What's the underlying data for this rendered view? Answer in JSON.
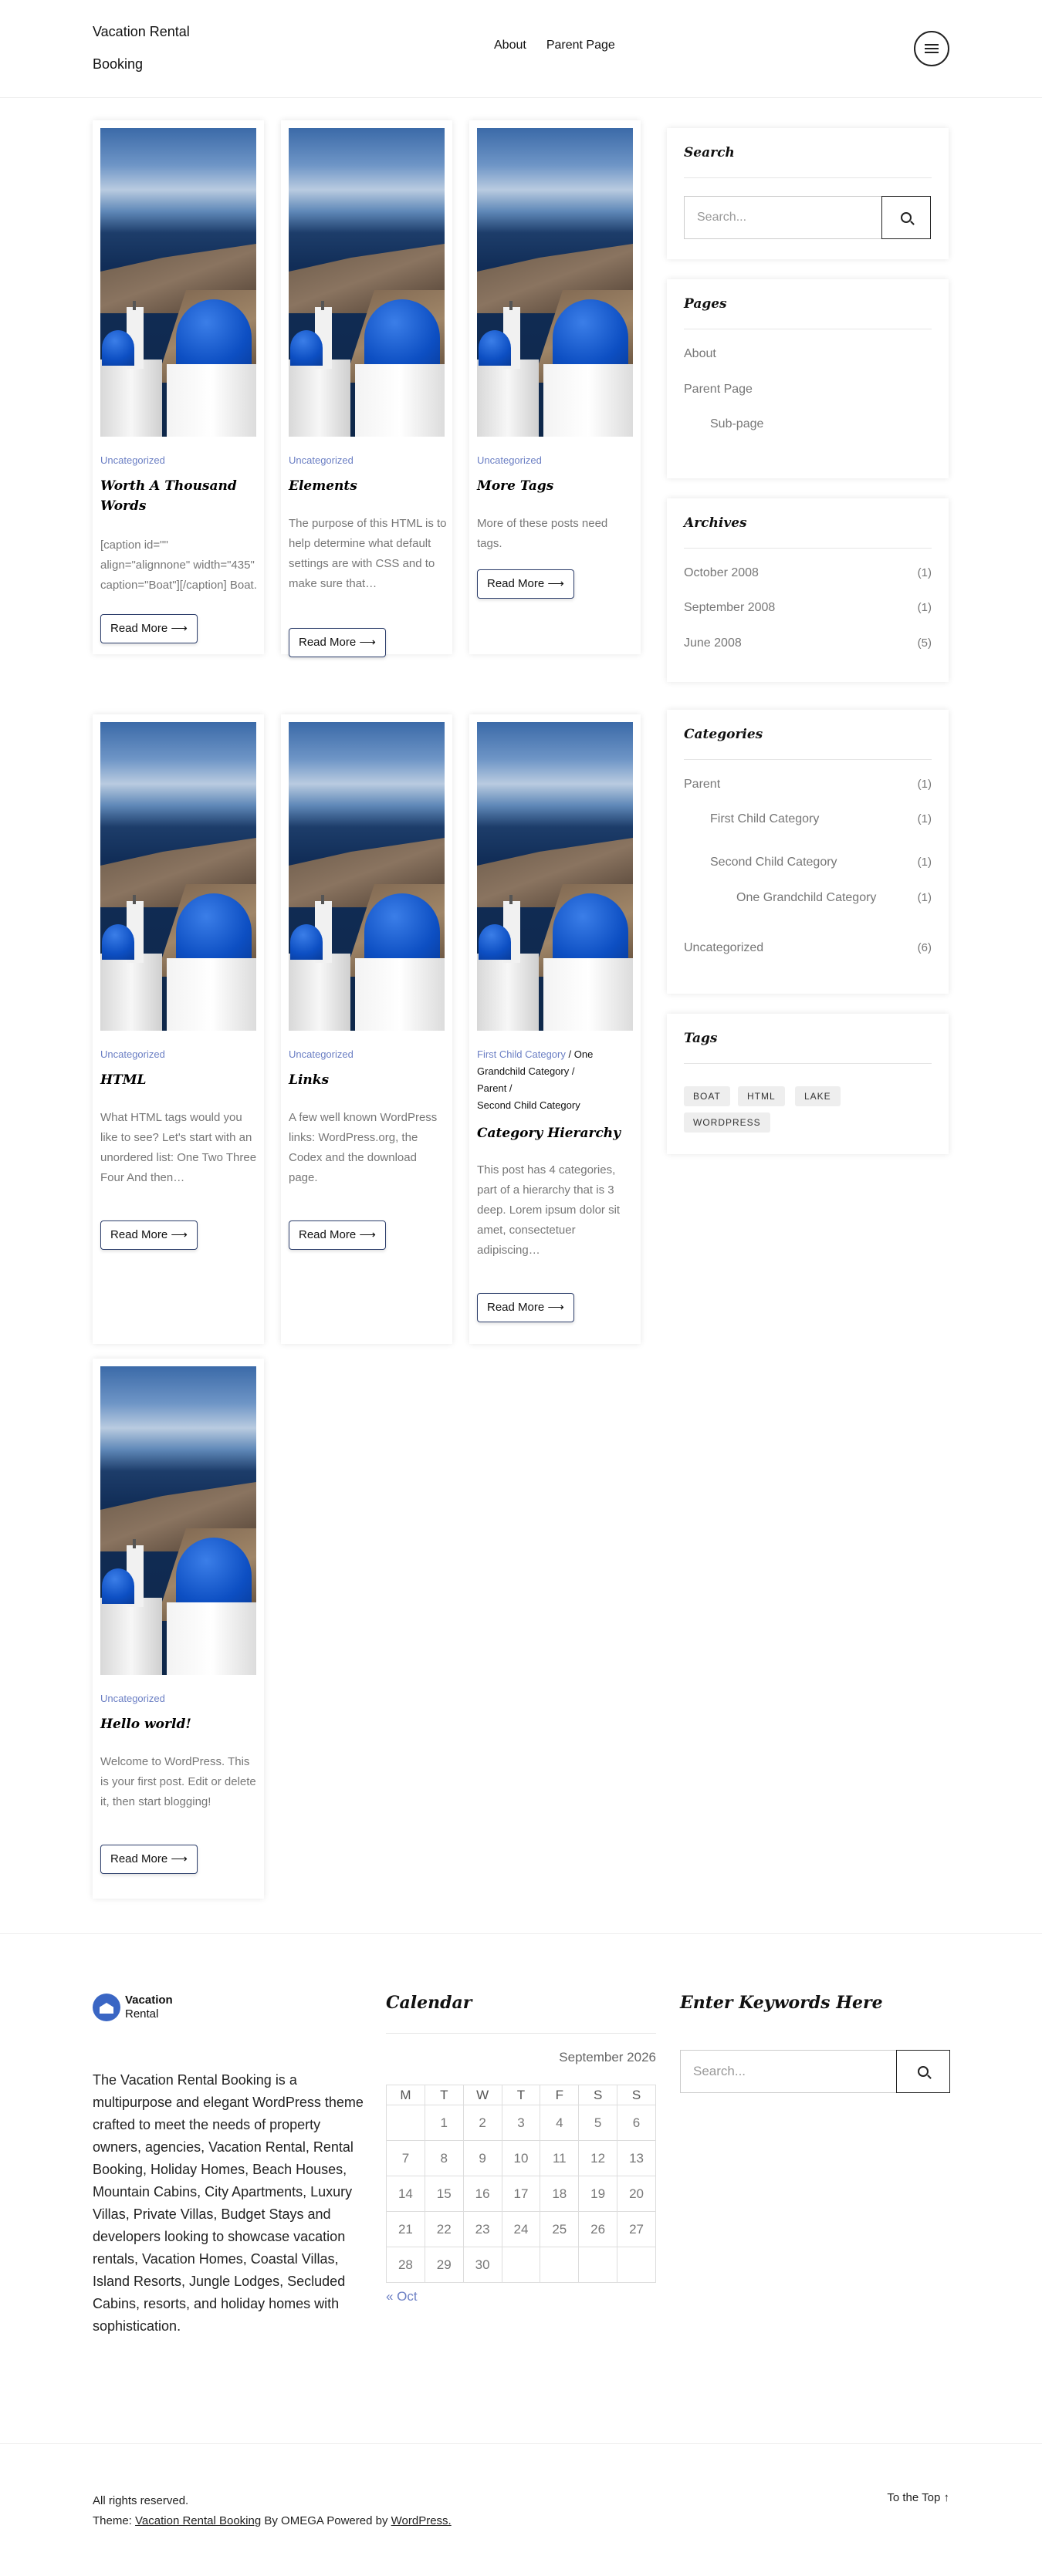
{
  "header": {
    "site_title": "Vacation Rental Booking",
    "nav": [
      "About",
      "Parent Page"
    ],
    "menu_icon": "hamburger-menu-icon"
  },
  "posts": [
    {
      "category": "Uncategorized",
      "title": "Worth A Thousand Words",
      "excerpt": "[caption id=\"\" align=\"alignnone\" width=\"435\" caption=\"Boat\"][/caption] Boat.",
      "read_more": "Read More ⟶"
    },
    {
      "category": "Uncategorized",
      "title": "Elements",
      "excerpt": "The purpose of this HTML is to help determine what default settings are with CSS and to make sure that…",
      "read_more": "Read More ⟶"
    },
    {
      "category": "Uncategorized",
      "title": "More Tags",
      "excerpt": "More of these posts need tags.",
      "read_more": "Read More ⟶"
    },
    {
      "category": "Uncategorized",
      "title": "HTML",
      "excerpt": "What HTML tags would you like to see? Let's start with an unordered list: One Two Three Four And then…",
      "read_more": "Read More ⟶"
    },
    {
      "category": "Uncategorized",
      "title": "Links",
      "excerpt": "A few well known WordPress links: WordPress.org, the Codex and the download page.",
      "read_more": "Read More ⟶"
    },
    {
      "categories": [
        "First Child Category",
        "One Grandchild Category",
        "Parent",
        "Second Child Category"
      ],
      "separator": " /",
      "title": "Category Hierarchy",
      "excerpt": "This post has 4 categories, part of a hierarchy that is 3 deep. Lorem ipsum dolor sit amet, consectetuer adipiscing…",
      "read_more": "Read More ⟶"
    },
    {
      "category": "Uncategorized",
      "title": "Hello world!",
      "excerpt": "Welcome to WordPress. This is your first post. Edit or delete it, then start blogging!",
      "read_more": "Read More ⟶"
    }
  ],
  "sidebar": {
    "search": {
      "title": "Search",
      "placeholder": "Search..."
    },
    "pages": {
      "title": "Pages",
      "items": [
        "About",
        "Parent Page",
        "Sub-page"
      ]
    },
    "archives": {
      "title": "Archives",
      "items": [
        {
          "label": "October 2008",
          "count": "(1)"
        },
        {
          "label": "September 2008",
          "count": "(1)"
        },
        {
          "label": "June 2008",
          "count": "(5)"
        }
      ]
    },
    "categories": {
      "title": "Categories",
      "items": [
        {
          "label": "Parent",
          "count": "(1)"
        },
        {
          "label": "First Child Category",
          "count": "(1)"
        },
        {
          "label": "Second Child Category",
          "count": "(1)"
        },
        {
          "label": "One Grandchild Category",
          "count": "(1)"
        },
        {
          "label": "Uncategorized",
          "count": "(6)"
        }
      ]
    },
    "tags": {
      "title": "Tags",
      "items": [
        "BOAT",
        "HTML",
        "LAKE",
        "WORDPRESS"
      ]
    }
  },
  "footer": {
    "logo": {
      "line1": "Vacation",
      "line2": "Rental"
    },
    "about": "The Vacation Rental Booking is a multipurpose and elegant WordPress theme crafted to meet the needs of property owners, agencies, Vacation Rental, Rental Booking, Holiday Homes, Beach Houses, Mountain Cabins, City Apartments, Luxury Villas, Private Villas, Budget Stays and developers looking to showcase vacation rentals, Vacation Homes, Coastal Villas, Island Resorts, Jungle Lodges, Secluded Cabins, resorts, and holiday homes with sophistication.",
    "calendar": {
      "title": "Calendar",
      "caption": "September 2026",
      "days": [
        "M",
        "T",
        "W",
        "T",
        "F",
        "S",
        "S"
      ],
      "weeks": [
        [
          "",
          "1",
          "2",
          "3",
          "4",
          "5",
          "6"
        ],
        [
          "7",
          "8",
          "9",
          "10",
          "11",
          "12",
          "13"
        ],
        [
          "14",
          "15",
          "16",
          "17",
          "18",
          "19",
          "20"
        ],
        [
          "21",
          "22",
          "23",
          "24",
          "25",
          "26",
          "27"
        ],
        [
          "28",
          "29",
          "30",
          "",
          "",
          "",
          ""
        ]
      ],
      "prev": "« Oct"
    },
    "keywords": {
      "title": "Enter Keywords Here",
      "placeholder": "Search..."
    },
    "rights": "All rights reserved.",
    "theme_prefix": "Theme:",
    "theme_link": "Vacation Rental Booking",
    "by": "By OMEGA Powered by",
    "wp_link": "WordPress.",
    "to_top": "To the Top ↑"
  }
}
